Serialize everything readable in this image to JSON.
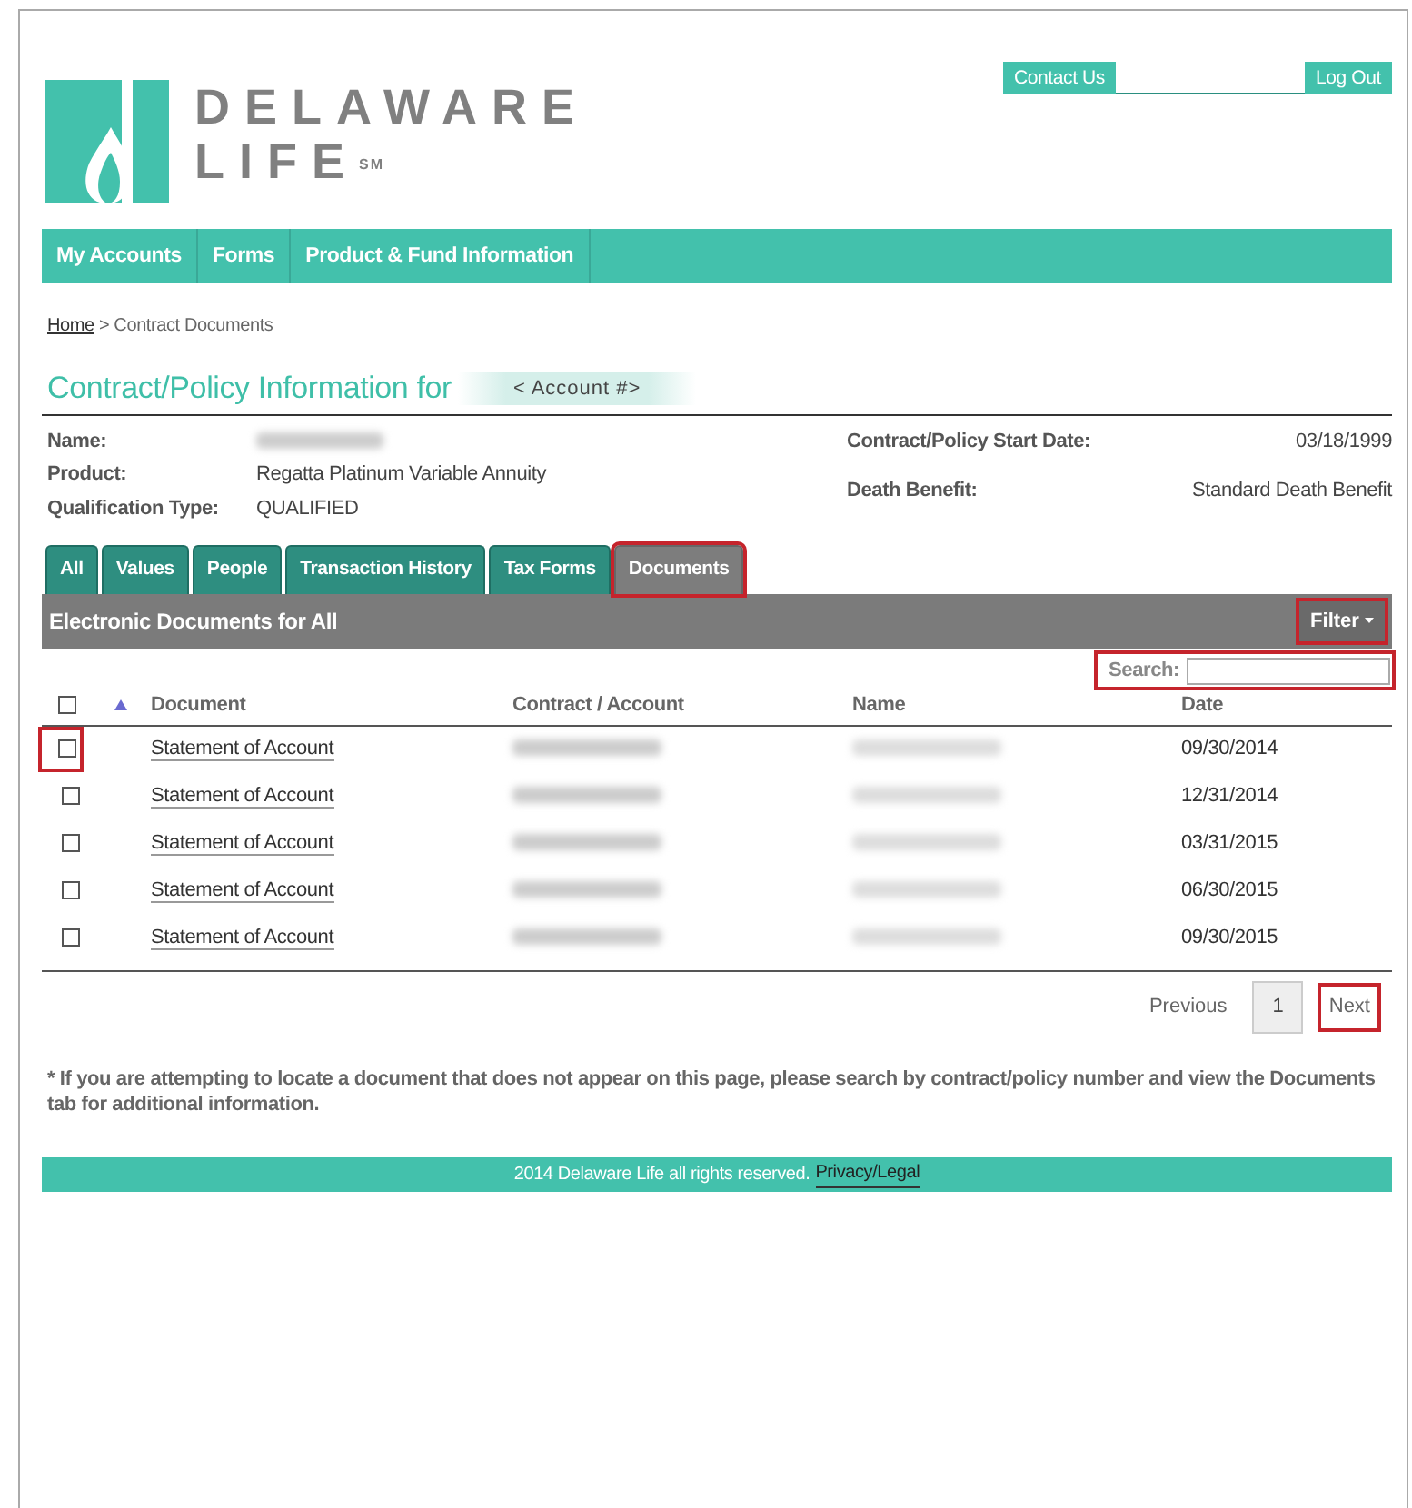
{
  "header": {
    "logo": {
      "line1": "DELAWARE",
      "line2": "LIFE",
      "mark": "SM"
    },
    "top_links": [
      {
        "label": "Contact Us"
      },
      {
        "label": "Log Out"
      }
    ]
  },
  "nav": [
    {
      "label": "My Accounts"
    },
    {
      "label": "Forms"
    },
    {
      "label": "Product & Fund Information"
    }
  ],
  "breadcrumb": {
    "link": "Home",
    "current": "> Contract Documents"
  },
  "title": {
    "text": "Contract/Policy Information for",
    "account": "< Account #>"
  },
  "details_left": [
    {
      "label": "Name:"
    },
    {
      "label": "Product:",
      "value": "Regatta Platinum Variable Annuity"
    },
    {
      "label": "Qualification Type:",
      "value": "QUALIFIED"
    }
  ],
  "details_right": [
    {
      "label": "Contract/Policy Start Date:",
      "value": "03/18/1999"
    },
    {
      "label": "Death Benefit:",
      "value": "Standard Death Benefit"
    }
  ],
  "tabs": [
    {
      "label": "All",
      "selected": false,
      "highlighted": false
    },
    {
      "label": "Values",
      "selected": false,
      "highlighted": false
    },
    {
      "label": "People",
      "selected": false,
      "highlighted": false
    },
    {
      "label": "Transaction History",
      "selected": false,
      "highlighted": false
    },
    {
      "label": "Tax Forms",
      "selected": false,
      "highlighted": false
    },
    {
      "label": "Documents",
      "selected": true,
      "highlighted": true
    }
  ],
  "panel": {
    "title": "Electronic Documents for All",
    "filter": {
      "label": "Filter",
      "highlighted": true
    },
    "search": {
      "label": "Search:",
      "highlighted": true
    }
  },
  "table": {
    "select_all": {
      "checked": false
    },
    "columns": [
      "Document",
      "Contract / Account",
      "Name",
      "Date"
    ],
    "rows": [
      {
        "checked": false,
        "highlighted": true,
        "document": "Statement of Account",
        "date": "09/30/2014"
      },
      {
        "checked": false,
        "highlighted": false,
        "document": "Statement of Account",
        "date": "12/31/2014"
      },
      {
        "checked": false,
        "highlighted": false,
        "document": "Statement of Account",
        "date": "03/31/2015"
      },
      {
        "checked": false,
        "highlighted": false,
        "document": "Statement of Account",
        "date": "06/30/2015"
      },
      {
        "checked": false,
        "highlighted": false,
        "document": "Statement of Account",
        "date": "09/30/2015"
      }
    ]
  },
  "pagination": [
    {
      "label": "Previous",
      "kind": "link",
      "selected": false,
      "highlighted": false
    },
    {
      "label": "1",
      "kind": "page",
      "selected": true,
      "highlighted": false
    },
    {
      "label": "Next",
      "kind": "link",
      "selected": false,
      "highlighted": true
    }
  ],
  "note": "* If you are attempting to locate a document that does not appear on this page, please search by contract/policy number and view the Documents tab for additional information.",
  "footer": {
    "text": "2014 Delaware Life all rights reserved.",
    "link": "Privacy/Legal"
  }
}
